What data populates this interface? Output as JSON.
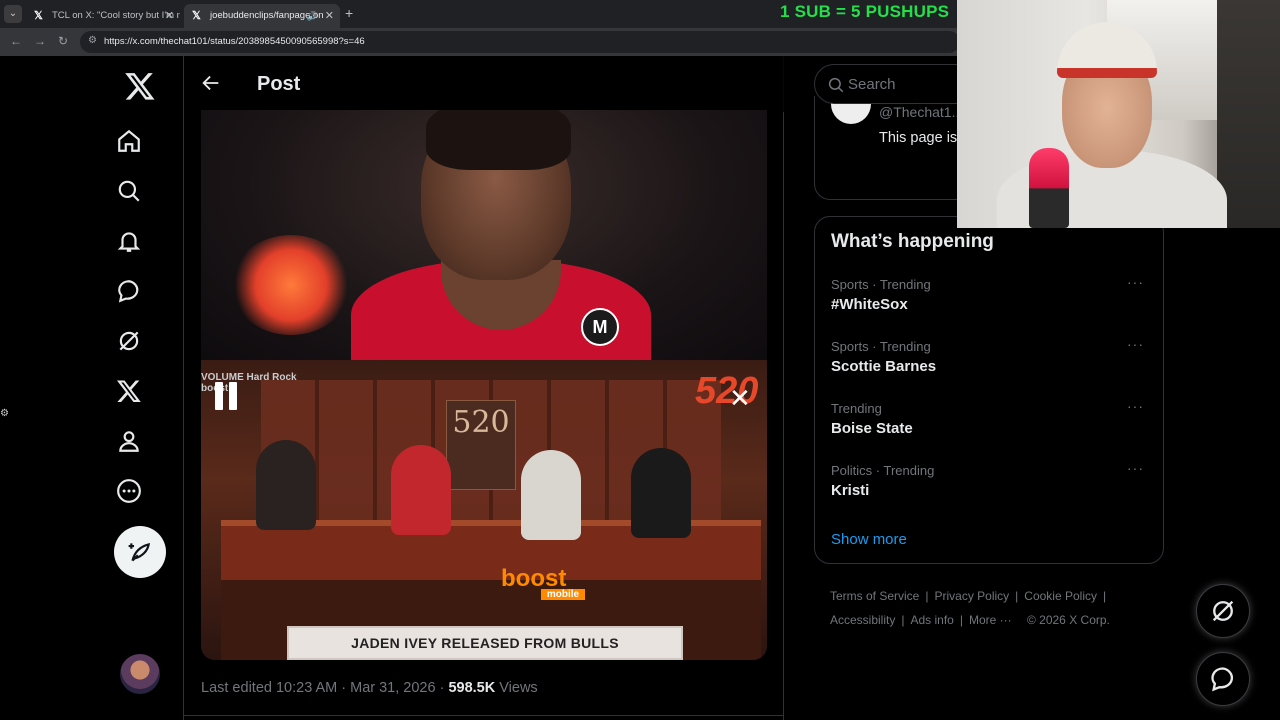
{
  "browser": {
    "tabs": [
      {
        "title": "TCL on X: \"Cool story but I'm no",
        "active": false
      },
      {
        "title": "joebuddenclips/fanpage on",
        "active": true
      }
    ],
    "url": "https://x.com/thechat101/status/2038985450090565998?s=46"
  },
  "stream_overlay": {
    "text": "1 SUB = 5 PUSHUPS"
  },
  "left_nav": {
    "items": [
      "home-icon",
      "explore-icon",
      "notifications-icon",
      "messages-icon",
      "grok-icon",
      "premium-x-icon",
      "profile-icon",
      "more-icon"
    ]
  },
  "post": {
    "header_title": "Post",
    "video_caption": "JADEN IVEY RELEASED FROM BULLS",
    "video_badge": "520",
    "video_sign": "520",
    "video_brand": "boost",
    "video_brand_sub": "mobile",
    "video_show_logo": "VOLUME  Hard Rock  boost",
    "meta": {
      "edited": "Last edited 10:23 AM · Mar 31, 2026 · ",
      "views_count": "598.5K",
      "views_label": " Views"
    }
  },
  "sidebar": {
    "search_placeholder": "Search",
    "profile_card": {
      "handle": "@Thechat1...",
      "bio": "This page is JBP this is a videos"
    },
    "happening": {
      "title": "What’s happening",
      "trends": [
        {
          "category": "Sports · Trending",
          "name": "#WhiteSox"
        },
        {
          "category": "Sports · Trending",
          "name": "Scottie Barnes"
        },
        {
          "category": "Trending",
          "name": "Boise State"
        },
        {
          "category": "Politics · Trending",
          "name": "Kristi"
        }
      ],
      "show_more": "Show more"
    },
    "footer": {
      "links": [
        "Terms of Service",
        "Privacy Policy",
        "Cookie Policy",
        "Accessibility",
        "Ads info",
        "More ···"
      ],
      "copyright": "© 2026 X Corp."
    }
  },
  "colors": {
    "accent": "#1d9bf0",
    "background": "#000000",
    "overlay_green": "#22e04a"
  }
}
